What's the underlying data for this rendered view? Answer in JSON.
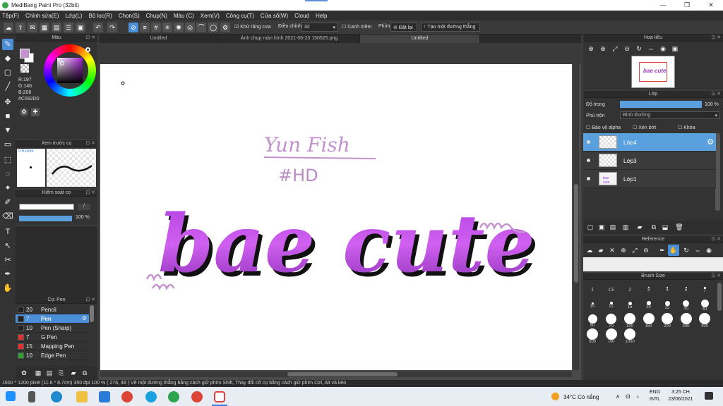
{
  "window": {
    "title": "MediBang Paint Pro (32bit)",
    "controls": [
      "—",
      "❐",
      "✕"
    ]
  },
  "menu": [
    "Tệp(F)",
    "Chỉnh sửa(E)",
    "Lớp(L)",
    "Bộ lọc(R)",
    "Chọn(S)",
    "Chụp(N)",
    "Màu (C)",
    "Xem(V)",
    "Công cụ(T)",
    "Cửa sổ(W)",
    "Cloud",
    "Help"
  ],
  "toolbar": {
    "antialias_label": "Khử răng cưa",
    "correction_label": "Điều chỉnh",
    "correction_value": "32",
    "smooth_label": "Canh mềm",
    "key_label": "Phím",
    "reset_label": "Đặt lại",
    "new_ruler_label": "Tạo một đường thẳng"
  },
  "tabs": [
    "Untitled",
    "Ảnh chụp màn hình 2021-06-23 150525.png",
    "Untitled"
  ],
  "color_panel": {
    "title": "Màu",
    "r": "R:197",
    "g": "G:146",
    "b": "B:208",
    "hex": "#C592D0",
    "primary_color": "#C592D0",
    "secondary_color": "#ffffff"
  },
  "preview_panel": {
    "title": "Xem trước cọ",
    "size": "0.51mm"
  },
  "brush_control": {
    "title": "Kiểm soát cọ",
    "opacity": "100 %"
  },
  "brush_panel": {
    "title": "Cọ: Pen",
    "items": [
      {
        "size": "20",
        "name": "Pencil",
        "color": "#222222"
      },
      {
        "size": "7",
        "name": "Pen",
        "color": "#222222"
      },
      {
        "size": "10",
        "name": "Pen (Sharp)",
        "color": "#222222"
      },
      {
        "size": "7",
        "name": "G Pen",
        "color": "#e03030"
      },
      {
        "size": "15",
        "name": "Mapping Pen",
        "color": "#e03030"
      },
      {
        "size": "10",
        "name": "Edge Pen",
        "color": "#30a030"
      }
    ]
  },
  "navigator": {
    "title": "Hoa tiêu"
  },
  "layer_panel": {
    "title": "Lớp",
    "opacity_label": "Độ trong",
    "opacity_value": "100 %",
    "blend_label": "Phủ trộn",
    "blend_value": "Bình thường",
    "protect_alpha": "Bảo vệ alpha",
    "clipping": "Xén bớt",
    "lock": "Khóa",
    "layers": [
      "Lớp4",
      "Lớp3",
      "Lớp1"
    ]
  },
  "reference_panel": {
    "title": "Reference"
  },
  "brush_size_panel": {
    "title": "Brush Size",
    "sizes": [
      "1",
      "1.5",
      "2",
      "3",
      "4",
      "5",
      "7",
      "10",
      "12",
      "15",
      "20",
      "25",
      "30",
      "40",
      "50",
      "70",
      "100",
      "150",
      "200",
      "300",
      "400",
      "500",
      "700",
      "1000"
    ]
  },
  "canvas_text": {
    "line1": "Yun Fish",
    "line2": "#HD",
    "main": "bae cute"
  },
  "status": "1600 * 1200 pixel   (11.6 * 8.7cm)   350 dpi   100 %   ( 276, 48 )   Vẽ một đường thẳng bằng cách giữ phím Shift, Thay đổi cỡ cọ bằng cách giữ phím Ctrl, Alt và kéo",
  "taskbar": {
    "weather": "34°C  Có nắng",
    "lang1": "ENG",
    "lang2": "INTL",
    "time": "3:25 CH",
    "date": "23/06/2021"
  }
}
